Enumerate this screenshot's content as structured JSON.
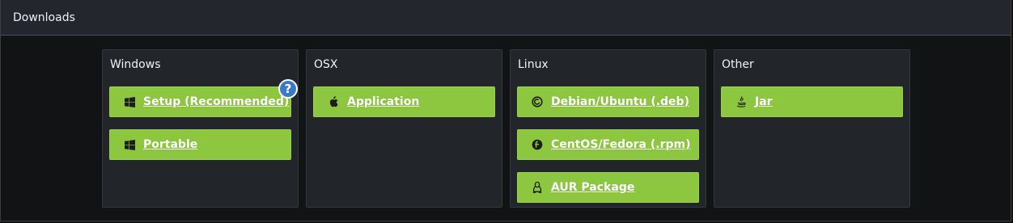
{
  "header": {
    "title": "Downloads"
  },
  "colors": {
    "button": "#8dc63f",
    "panel": "#22252a",
    "help": "#3a78c9"
  },
  "columns": [
    {
      "title": "Windows",
      "buttons": [
        {
          "label": "Setup (Recommended)",
          "icon": "windows-icon",
          "help": "?"
        },
        {
          "label": "Portable",
          "icon": "windows-icon"
        }
      ]
    },
    {
      "title": "OSX",
      "buttons": [
        {
          "label": "Application",
          "icon": "apple-icon"
        }
      ]
    },
    {
      "title": "Linux",
      "buttons": [
        {
          "label": "Debian/Ubuntu (.deb)",
          "icon": "debian-icon"
        },
        {
          "label": "CentOS/Fedora (.rpm)",
          "icon": "fedora-icon"
        },
        {
          "label": "AUR Package",
          "icon": "linux-icon"
        }
      ]
    },
    {
      "title": "Other",
      "buttons": [
        {
          "label": "Jar",
          "icon": "java-icon"
        }
      ]
    }
  ]
}
